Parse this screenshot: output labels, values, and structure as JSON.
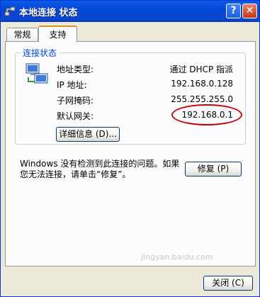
{
  "window": {
    "title": "本地连接 状态",
    "help_label": "?",
    "close_label": "✕"
  },
  "tabs": [
    {
      "label": "常规"
    },
    {
      "label": "支持"
    }
  ],
  "connection_status": {
    "group_label": "连接状态",
    "icon": "network-connection-icon",
    "rows": [
      {
        "label": "地址类型:",
        "value": "通过 DHCP 指派"
      },
      {
        "label": "IP 地址:",
        "value": "192.168.0.128"
      },
      {
        "label": "子网掩码:",
        "value": "255.255.255.0"
      },
      {
        "label": "默认网关:",
        "value": "192.168.0.1"
      }
    ],
    "details_button": "详细信息 (D)..."
  },
  "message": "Windows 没有检测到此连接的问题。如果您无法连接，请单击“修复”。",
  "repair_button": "修复 (P)",
  "close_button": "关闭 (C)",
  "watermark": "jingyan.baidu.com",
  "colors": {
    "accent": "#0046d5",
    "highlight": "#cc0000",
    "tab_accent": "#e68b2c"
  }
}
